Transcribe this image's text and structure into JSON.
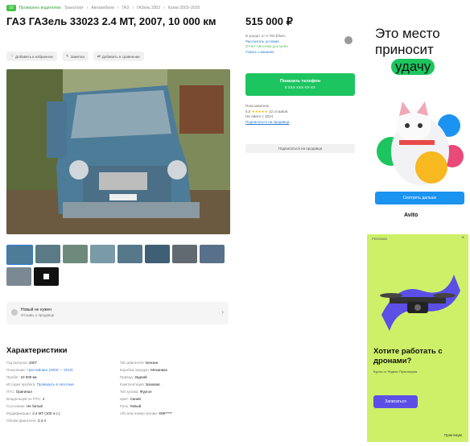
{
  "breadcrumb": {
    "badge": "10",
    "items": [
      "Проверено водителем",
      "Транспорт",
      "Автомобили",
      "ГАЗ",
      "ГАЗель 3302",
      "Кузов 2003–2010"
    ]
  },
  "listing": {
    "title": "ГАЗ ГАЗель 33023 2.4 MT, 2007, 10 000 км",
    "price": "515 000 ₽",
    "actions": [
      "Добавить в избранное",
      "Заметка",
      "Добавить в сравнение"
    ]
  },
  "price_info": {
    "lines": [
      "В кредит от 9 750 ₽/мес.",
      "Рассчитать условия",
      "Отчёт Автотеки доступен",
      "Узнать о машине"
    ]
  },
  "contact": {
    "call_label": "Показать телефон",
    "call_sub": "8 XXX XXX-XX-XX",
    "seller_label": "Пользователь",
    "rating": "5,0",
    "stars": "★★★★★",
    "reviews": "12 отзывов",
    "since": "На Авито с 2014",
    "link": "Подписаться на продавца",
    "subscribe": "Подписаться на продавца"
  },
  "notice": {
    "title": "Новый не нужен",
    "subtitle": "Отзывы о продавце"
  },
  "characteristics": {
    "title": "Характеристики",
    "left": [
      {
        "k": "Год выпуска:",
        "v": "2007"
      },
      {
        "k": "Поколение:",
        "v": "I рестайлинг (2003 — 2010)",
        "link": true
      },
      {
        "k": "Пробег:",
        "v": "10 000 км"
      },
      {
        "k": "История пробега:",
        "v": "Проверить в Автотеке",
        "link": true
      },
      {
        "k": "ПТС:",
        "v": "Оригинал"
      },
      {
        "k": "Владельцев по ПТС:",
        "v": "4"
      },
      {
        "k": "Состояние:",
        "v": "Не битый"
      },
      {
        "k": "Модификация:",
        "v": "2.4 MT (100 л.с.)"
      },
      {
        "k": "Объём двигателя:",
        "v": "2.4 л"
      }
    ],
    "right": [
      {
        "k": "Тип двигателя:",
        "v": "Бензин"
      },
      {
        "k": "Коробка передач:",
        "v": "Механика"
      },
      {
        "k": "Привод:",
        "v": "Задний"
      },
      {
        "k": "Комплектация:",
        "v": "Базовая"
      },
      {
        "k": "Тип кузова:",
        "v": "Фургон"
      },
      {
        "k": "Цвет:",
        "v": "Синий"
      },
      {
        "k": "Руль:",
        "v": "Левый"
      },
      {
        "k": "VIN или номер кузова:",
        "v": "Х96*****"
      }
    ]
  },
  "ad_avito": {
    "headline": "Это место приносит",
    "highlight": "удачу",
    "button": "Смотреть дальше",
    "brand": "Avito"
  },
  "ad_drones": {
    "top": "РЕКЛАМА",
    "headline": "Хотите работать с дронами?",
    "sub": "Курсы от Яндекс Практикума",
    "button": "Записаться",
    "brand": "Практикум"
  }
}
